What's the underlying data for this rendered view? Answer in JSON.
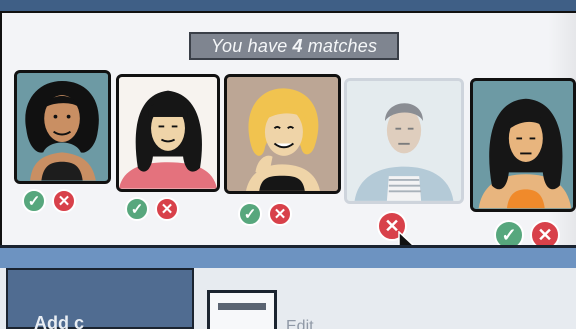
{
  "header": {
    "prefix": "You have",
    "count": "4",
    "suffix": "matches"
  },
  "matches": [
    {
      "portrait": "woman-curly-hair",
      "actions": [
        "accept",
        "reject"
      ]
    },
    {
      "portrait": "woman-bangs-black-hair",
      "actions": [
        "accept",
        "reject"
      ]
    },
    {
      "portrait": "woman-blonde-wavy-hair",
      "actions": [
        "accept",
        "reject"
      ]
    },
    {
      "portrait": "man-denim-jacket-rejected",
      "actions": [
        "reject"
      ]
    },
    {
      "portrait": "woman-long-black-hair",
      "actions": [
        "accept",
        "reject"
      ]
    }
  ],
  "icons": {
    "accept": "check-icon",
    "reject": "x-icon",
    "pointer": "cursor-icon"
  },
  "lower": {
    "add_label": "Add c",
    "edit_label": "Edit"
  },
  "colors": {
    "accept": "#57a77d",
    "reject": "#d8414a",
    "accent_band": "#6d93c1"
  }
}
